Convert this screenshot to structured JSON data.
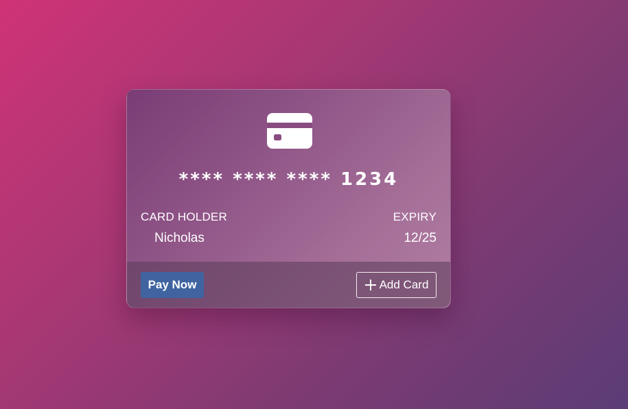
{
  "card": {
    "icon": "credit-card-icon",
    "number": "**** **** **** 1234",
    "holder_label": "CARD HOLDER",
    "holder_name": "Nicholas",
    "expiry_label": "EXPIRY",
    "expiry_value": "12/25"
  },
  "actions": {
    "pay_label": "Pay Now",
    "add_label": "Add Card",
    "add_icon": "plus-icon"
  },
  "colors": {
    "background_start": "#cf3376",
    "background_end": "#5b3c76",
    "pay_button": "#3f64a0",
    "text": "#ffffff"
  }
}
